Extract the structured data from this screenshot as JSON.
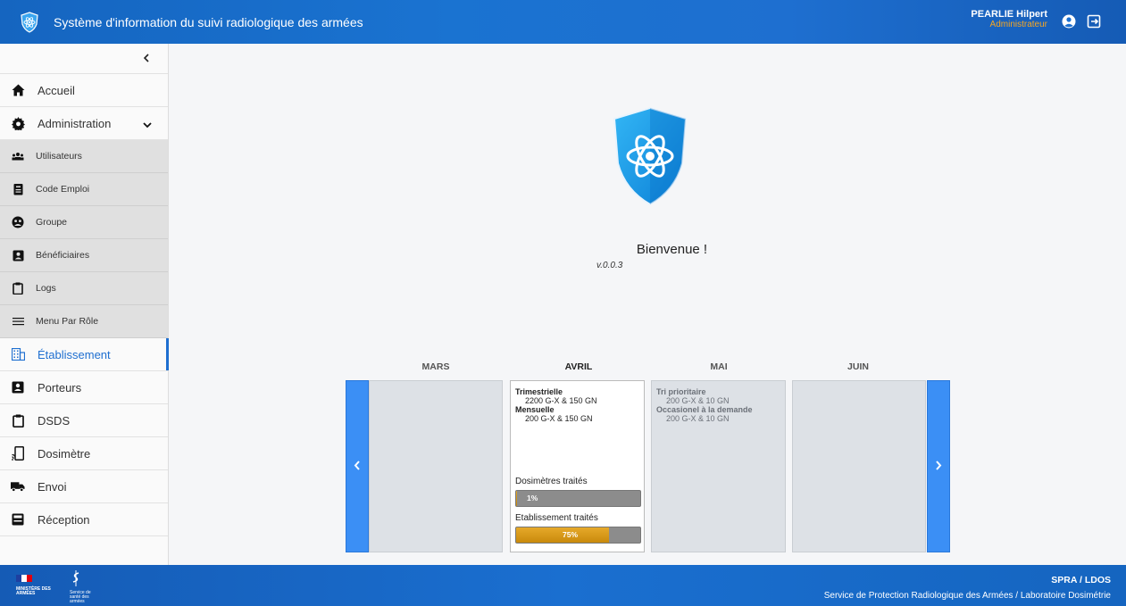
{
  "header": {
    "title": "Système d'information du suivi radiologique des armées",
    "user_name": "PEARLIE Hilpert",
    "user_role": "Administrateur"
  },
  "sidebar": {
    "items": [
      {
        "label": "Accueil",
        "icon": "home-icon"
      },
      {
        "label": "Administration",
        "icon": "gear-icon"
      },
      {
        "label": "Utilisateurs",
        "icon": "users-icon"
      },
      {
        "label": "Code Emploi",
        "icon": "badge-icon"
      },
      {
        "label": "Groupe",
        "icon": "group-icon"
      },
      {
        "label": "Bénéficiaires",
        "icon": "id-card-icon"
      },
      {
        "label": "Logs",
        "icon": "clipboard-icon"
      },
      {
        "label": "Menu Par Rôle",
        "icon": "menu-icon"
      },
      {
        "label": "Établissement",
        "icon": "building-icon"
      },
      {
        "label": "Porteurs",
        "icon": "user-card-icon"
      },
      {
        "label": "DSDS",
        "icon": "clipboard-icon"
      },
      {
        "label": "Dosimètre",
        "icon": "dosimeter-icon"
      },
      {
        "label": "Envoi",
        "icon": "truck-icon"
      },
      {
        "label": "Réception",
        "icon": "inbox-icon"
      }
    ]
  },
  "main": {
    "welcome": "Bienvenue !",
    "version": "v.0.0.3",
    "months": [
      "MARS",
      "AVRIL",
      "MAI",
      "JUIN"
    ],
    "avril": {
      "line1": "Trimestrielle",
      "line2": "2200 G-X & 150 GN",
      "line3": "Mensuelle",
      "line4": "200 G-X & 150 GN",
      "bar1_label": "Dosimètres traités",
      "bar1_value": "1%",
      "bar1_fraction": 0.01,
      "bar2_label": "Etablissement traités",
      "bar2_value": "75%",
      "bar2_fraction": 0.75
    },
    "mai": {
      "line1": "Tri prioritaire",
      "line2": "200 G-X & 10 GN",
      "line3": "Occasionel à la demande",
      "line4": "200 G-X & 10 GN"
    }
  },
  "footer": {
    "code": "SPRA / LDOS",
    "org": "Service de Protection Radiologique des Armées / Laboratoire Dosimétrie",
    "ministry": "MINISTÈRE DES ARMÉES",
    "ssa": "Service de santé des armées"
  },
  "colors": {
    "primary": "#1e6fd0",
    "accent": "#f5a623",
    "progress": "#d99a18"
  }
}
